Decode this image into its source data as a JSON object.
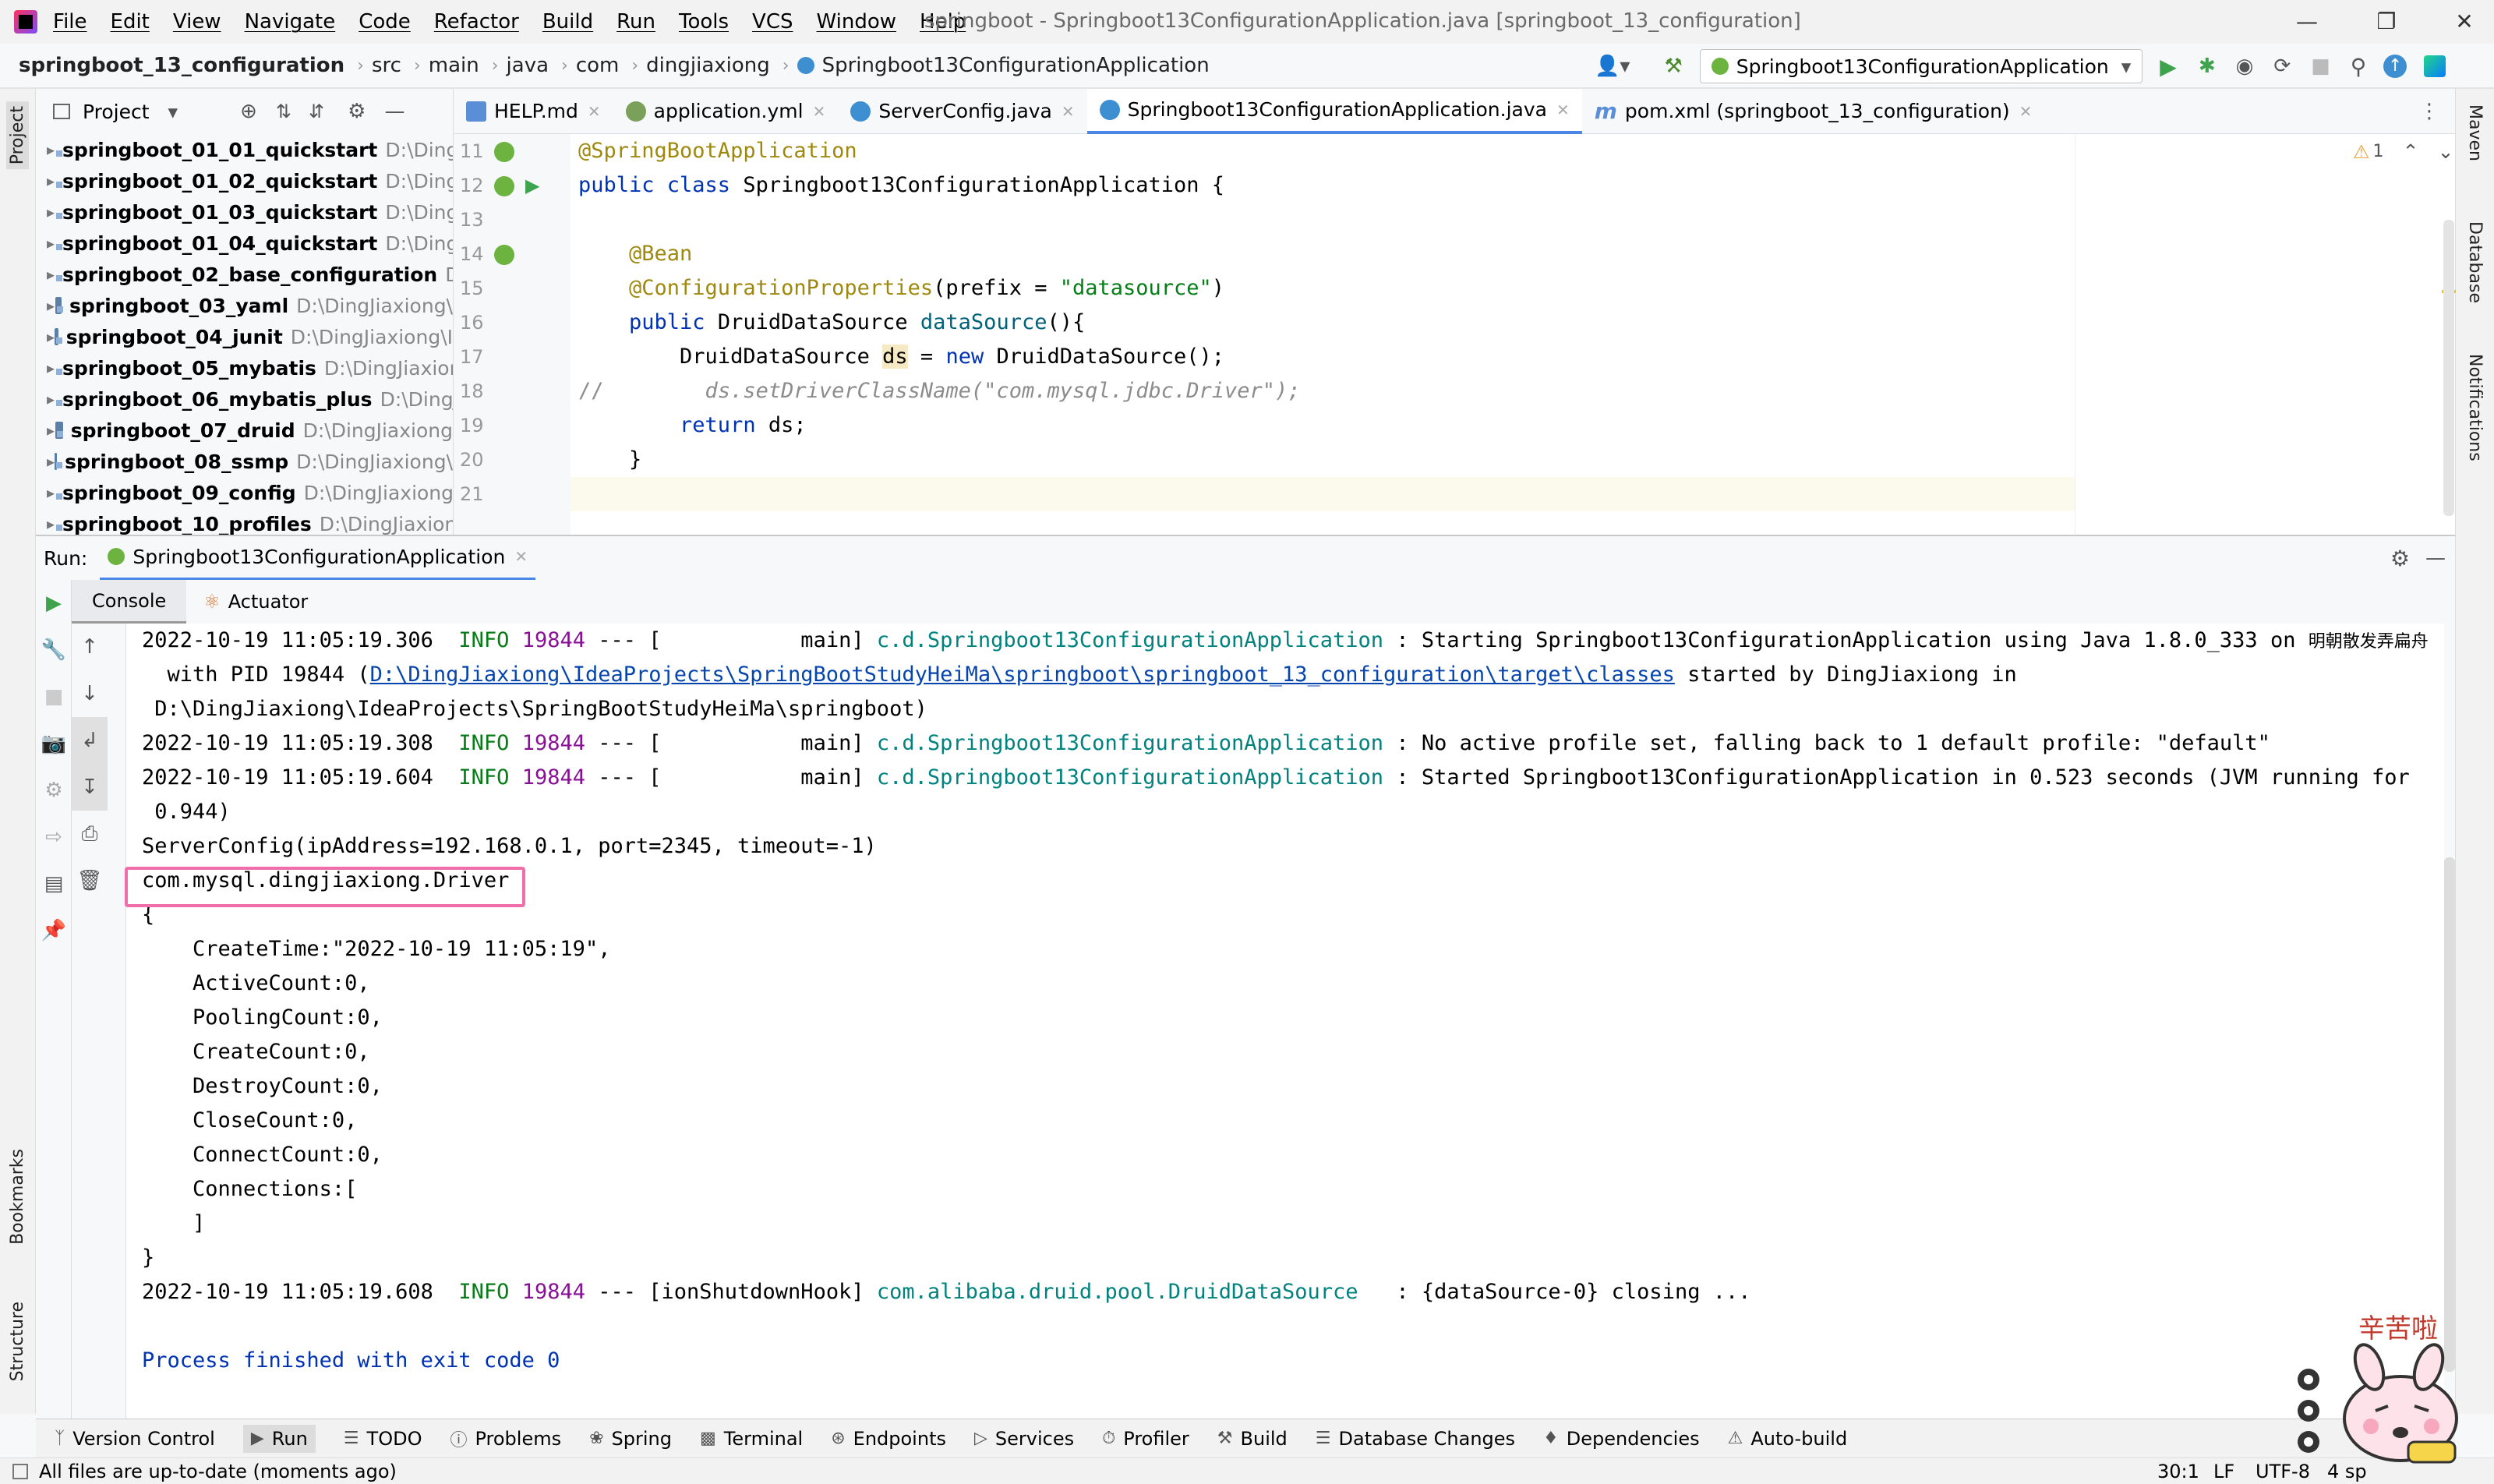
{
  "window": {
    "title": "springboot - Springboot13ConfigurationApplication.java [springboot_13_configuration]",
    "menu": [
      "File",
      "Edit",
      "View",
      "Navigate",
      "Code",
      "Refactor",
      "Build",
      "Run",
      "Tools",
      "VCS",
      "Window",
      "Help"
    ]
  },
  "breadcrumb": [
    "springboot_13_configuration",
    "src",
    "main",
    "java",
    "com",
    "dingjiaxiong",
    "Springboot13ConfigurationApplication"
  ],
  "run_config": "Springboot13ConfigurationApplication",
  "project_panel": {
    "title": "Project",
    "items": [
      {
        "name": "springboot_01_01_quickstart",
        "path": "D:\\Ding"
      },
      {
        "name": "springboot_01_02_quickstart",
        "path": "D:\\Ding"
      },
      {
        "name": "springboot_01_03_quickstart",
        "path": "D:\\Ding"
      },
      {
        "name": "springboot_01_04_quickstart",
        "path": "D:\\Ding"
      },
      {
        "name": "springboot_02_base_configuration",
        "path": "D"
      },
      {
        "name": "springboot_03_yaml",
        "path": "D:\\DingJiaxiong\\"
      },
      {
        "name": "springboot_04_junit",
        "path": "D:\\DingJiaxiong\\I"
      },
      {
        "name": "springboot_05_mybatis",
        "path": "D:\\DingJiaxior"
      },
      {
        "name": "springboot_06_mybatis_plus",
        "path": "D:\\DingJ"
      },
      {
        "name": "springboot_07_druid",
        "path": "D:\\DingJiaxiong"
      },
      {
        "name": "springboot_08_ssmp",
        "path": "D:\\DingJiaxiong\\"
      },
      {
        "name": "springboot_09_config",
        "path": "D:\\DingJiaxiong"
      },
      {
        "name": "springboot_10_profiles",
        "path": "D:\\DingJiaxion"
      }
    ]
  },
  "tabs": [
    {
      "label": "HELP.md",
      "color": "#5a8fd8"
    },
    {
      "label": "application.yml",
      "color": "#7aa05a"
    },
    {
      "label": "ServerConfig.java",
      "color": "#3d8fd1"
    },
    {
      "label": "Springboot13ConfigurationApplication.java",
      "color": "#3d8fd1"
    },
    {
      "label": "pom.xml (springboot_13_configuration)",
      "color": "#5a8fd8"
    }
  ],
  "editor": {
    "line_numbers": [
      "11",
      "12",
      "13",
      "14",
      "15",
      "16",
      "17",
      "18",
      "19",
      "20",
      "21"
    ],
    "warning_count": "1",
    "code": {
      "l11": "@SpringBootApplication",
      "l12a": "public class ",
      "l12b": "Springboot13ConfigurationApplication {",
      "l14": "    @Bean",
      "l15a": "    @ConfigurationProperties",
      "l15b": "(prefix = ",
      "l15c": "\"datasource\"",
      "l15d": ")",
      "l16a": "    public ",
      "l16b": "DruidDataSource ",
      "l16c": "dataSource",
      "l16d": "(){",
      "l17a": "        DruidDataSource ",
      "l17b": "ds",
      "l17c": " = ",
      "l17d": "new ",
      "l17e": "DruidDataSource();",
      "l18a": "//",
      "l18b": "        ds.setDriverClassName(\"com.mysql.jdbc.Driver\");",
      "l19a": "        return ",
      "l19b": "ds;",
      "l20": "    }"
    }
  },
  "run": {
    "label": "Run:",
    "config_tab": "Springboot13ConfigurationApplication",
    "subtabs": [
      "Console",
      "Actuator"
    ]
  },
  "console": {
    "l1_time": "2022-10-19 11:05:19.306",
    "l1_level": "INFO",
    "l1_pid": "19844",
    "l1_thread": " --- [           main] ",
    "l1_class": "c.d.Springboot13ConfigurationApplication",
    "l1_msg": " : Starting Springboot13ConfigurationApplication using Java 1.8.0_333 on ",
    "l1_host": "明朝散发弄扁舟",
    "l2_pre": "  with PID 19844 (",
    "l2_link": "D:\\DingJiaxiong\\IdeaProjects\\SpringBootStudyHeiMa\\springboot\\springboot_13_configuration\\target\\classes",
    "l2_post": " started by DingJiaxiong in",
    "l3": " D:\\DingJiaxiong\\IdeaProjects\\SpringBootStudyHeiMa\\springboot)",
    "l4_time": "2022-10-19 11:05:19.308",
    "l4_level": "INFO",
    "l4_pid": "19844",
    "l4_thread": " --- [           main] ",
    "l4_class": "c.d.Springboot13ConfigurationApplication",
    "l4_msg": " : No active profile set, falling back to 1 default profile: \"default\"",
    "l5_time": "2022-10-19 11:05:19.604",
    "l5_level": "INFO",
    "l5_pid": "19844",
    "l5_thread": " --- [           main] ",
    "l5_class": "c.d.Springboot13ConfigurationApplication",
    "l5_msg": " : Started Springboot13ConfigurationApplication in 0.523 seconds (JVM running for",
    "l6": " 0.944)",
    "l7": "ServerConfig(ipAddress=192.168.0.1, port=2345, timeout=-1)",
    "l8": "com.mysql.dingjiaxiong.Driver",
    "l9": "{",
    "l10": "    CreateTime:\"2022-10-19 11:05:19\",",
    "l11": "    ActiveCount:0,",
    "l12": "    PoolingCount:0,",
    "l13": "    CreateCount:0,",
    "l14": "    DestroyCount:0,",
    "l15": "    CloseCount:0,",
    "l16": "    ConnectCount:0,",
    "l17": "    Connections:[",
    "l18": "    ]",
    "l19": "}",
    "l20_time": "2022-10-19 11:05:19.608",
    "l20_level": "INFO",
    "l20_pid": "19844",
    "l20_thread": " --- [ionShutdownHook] ",
    "l20_class": "com.alibaba.druid.pool.DruidDataSource",
    "l20_msg": "   : {dataSource-0} closing ...",
    "l22": "Process finished with exit code 0"
  },
  "bottom_tools": [
    "Version Control",
    "Run",
    "TODO",
    "Problems",
    "Spring",
    "Terminal",
    "Endpoints",
    "Services",
    "Profiler",
    "Build",
    "Database Changes",
    "Dependencies",
    "Auto-build"
  ],
  "status": {
    "message": "All files are up-to-date (moments ago)",
    "position": "30:1",
    "line_sep": "LF",
    "encoding": "UTF-8",
    "indent": "4 sp"
  },
  "side_labels": {
    "left": [
      "Project",
      "Bookmarks",
      "Structure"
    ],
    "right": [
      "Maven",
      "Database",
      "Notifications"
    ]
  },
  "sticker_text": "辛苦啦"
}
